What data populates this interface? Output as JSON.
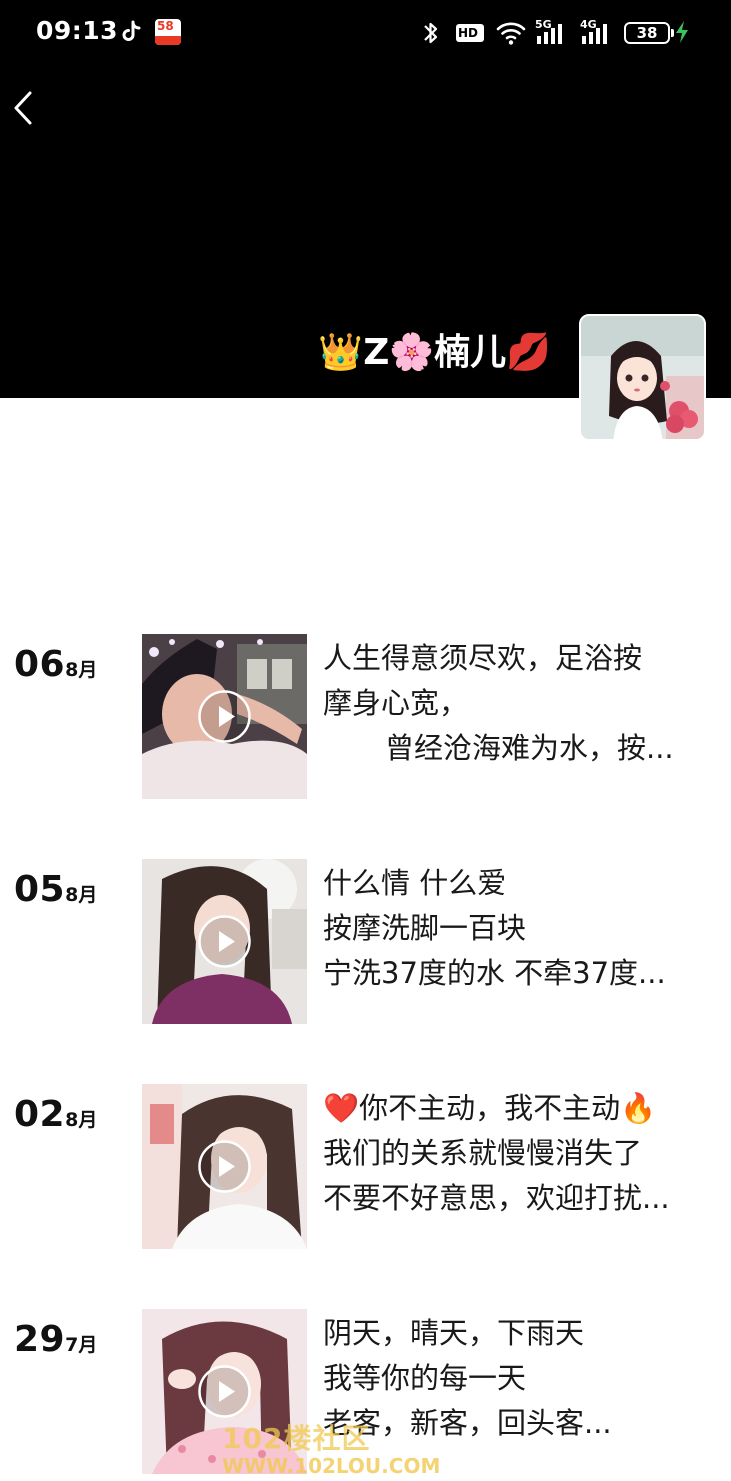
{
  "status_bar": {
    "time": "09:13",
    "hd_badge": "HD",
    "signal_5g": "5G",
    "signal_4g": "4G",
    "battery_level": "38"
  },
  "header": {
    "profile_name": "👑Z🌸楠儿💋"
  },
  "moments": [
    {
      "day": "06",
      "month": "8月",
      "lines": [
        "人生得意须尽欢，足浴按",
        "摩身心宽，",
        "曾经沧海难为水，按..."
      ],
      "has_video": true
    },
    {
      "day": "05",
      "month": "8月",
      "lines": [
        "什么情  什么爱",
        "按摩洗脚一百块",
        "宁洗37度的水 不牵37度..."
      ],
      "has_video": true
    },
    {
      "day": "02",
      "month": "8月",
      "lines": [
        "❤️你不主动，我不主动🔥",
        "我们的关系就慢慢消失了",
        "不要不好意思，欢迎打扰..."
      ],
      "has_video": true
    },
    {
      "day": "29",
      "month": "7月",
      "lines": [
        "阴天，晴天，下雨天",
        "我等你的每一天",
        "老客，新客，回头客..."
      ],
      "has_video": true
    }
  ],
  "watermark": {
    "title": "102楼社区",
    "url": "WWW.102LOU.COM"
  },
  "colors": {
    "cover_background": "#000000",
    "page_background": "#ffffff",
    "text_primary": "#191919",
    "watermark": "#f0c850"
  }
}
